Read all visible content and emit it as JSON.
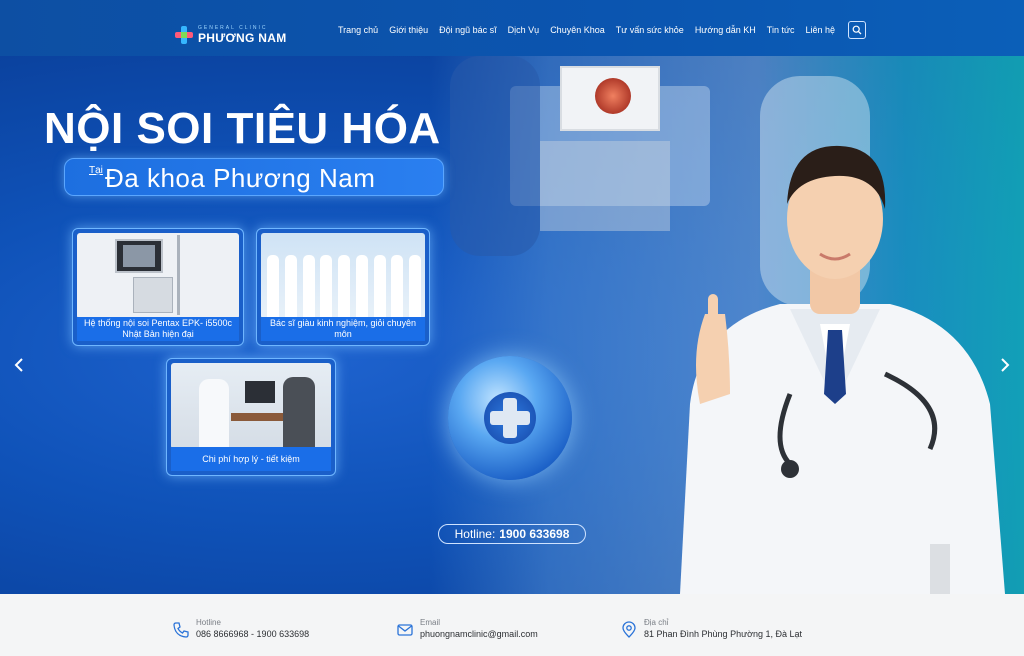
{
  "header": {
    "logo_small": "GENERAL CLINIC",
    "logo_big": "PHƯƠNG NAM",
    "nav": [
      "Trang chủ",
      "Giới thiệu",
      "Đội ngũ bác sĩ",
      "Dịch Vụ",
      "Chuyên Khoa",
      "Tư vấn sức khỏe",
      "Hướng dẫn KH",
      "Tin tức",
      "Liên hệ"
    ],
    "search_icon": "search-icon"
  },
  "hero": {
    "title": "NỘI SOI TIÊU HÓA",
    "sub_prefix": "Tại",
    "sub_title": "Đa khoa Phương Nam",
    "cards": [
      {
        "caption": "Hệ thống nội soi Pentax EPK- i5500c Nhật Bản hiện đại"
      },
      {
        "caption": "Bác sĩ giàu kinh nghiệm, giỏi chuyên môn"
      },
      {
        "caption": "Chi phí hợp lý - tiết kiệm"
      }
    ],
    "hotline_label": "Hotline:",
    "hotline_number": "1900 633698",
    "prev_icon": "chevron-left-icon",
    "next_icon": "chevron-right-icon"
  },
  "infobar": {
    "hotline": {
      "label": "Hotline",
      "value": "086 8666968 - 1900 633698",
      "icon": "phone-icon"
    },
    "email": {
      "label": "Email",
      "value": "phuongnamclinic@gmail.com",
      "icon": "mail-icon"
    },
    "address": {
      "label": "Địa chỉ",
      "value": "81 Phan Đình Phùng Phường 1, Đà Lạt",
      "icon": "location-pin-icon"
    }
  },
  "colors": {
    "brand_blue": "#0b55b0",
    "accent": "#1a6ee8",
    "teal": "#14bebe"
  }
}
